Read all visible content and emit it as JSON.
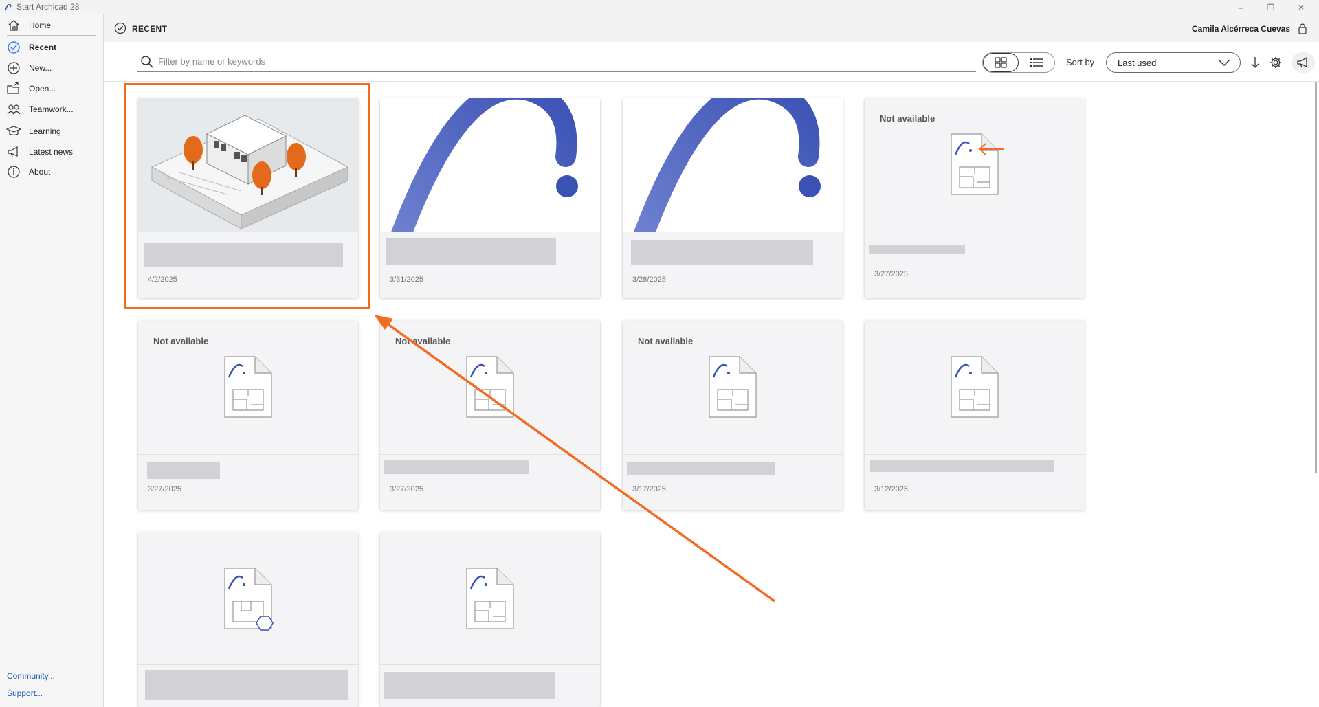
{
  "window": {
    "title": "Start Archicad 28",
    "controls": [
      "–",
      "❐",
      "✕"
    ]
  },
  "sidebar": {
    "items": [
      {
        "label": "Home",
        "icon": "home-icon"
      },
      {
        "label": "Recent",
        "icon": "recent-icon",
        "active": true
      },
      {
        "label": "New...",
        "icon": "new-icon"
      },
      {
        "label": "Open...",
        "icon": "open-icon"
      },
      {
        "label": "Teamwork...",
        "icon": "teamwork-icon"
      },
      {
        "label": "Learning",
        "icon": "learning-icon"
      },
      {
        "label": "Latest news",
        "icon": "megaphone-icon"
      },
      {
        "label": "About",
        "icon": "info-icon"
      }
    ],
    "links": [
      "Community...",
      "Support..."
    ]
  },
  "header": {
    "title": "RECENT",
    "user": "Camila Alcérreca Cuevas"
  },
  "toolbar": {
    "search_placeholder": "Filter by name or keywords",
    "sort_label": "Sort by",
    "sort_value": "Last used"
  },
  "cards": [
    {
      "thumb": "building",
      "name_hidden": true,
      "date": "4/2/2025"
    },
    {
      "thumb": "archicad-logo",
      "name_hidden": true,
      "date": "3/31/2025"
    },
    {
      "thumb": "archicad-logo",
      "name_hidden": true,
      "date": "3/28/2025"
    },
    {
      "thumb": "not-available",
      "label": "Not available",
      "name_hidden": true,
      "date": "3/27/2025"
    },
    {
      "thumb": "not-available",
      "label": "Not available",
      "name_hidden": true,
      "date": "3/27/2025"
    },
    {
      "thumb": "not-available",
      "label": "Not available",
      "name_hidden": true,
      "date": "3/27/2025"
    },
    {
      "thumb": "not-available",
      "label": "Not available",
      "name_hidden": true,
      "date": "3/17/2025"
    },
    {
      "thumb": "file-icon",
      "name_hidden": true,
      "date": "3/12/2025"
    },
    {
      "thumb": "file-icon-teamwork",
      "name_hidden": true,
      "date": ""
    },
    {
      "thumb": "file-icon",
      "name_hidden": true,
      "date": ""
    }
  ],
  "colors": {
    "annotation": "#f26b21",
    "logo_blue": "#3a52b4",
    "link": "#1a5bb5"
  }
}
